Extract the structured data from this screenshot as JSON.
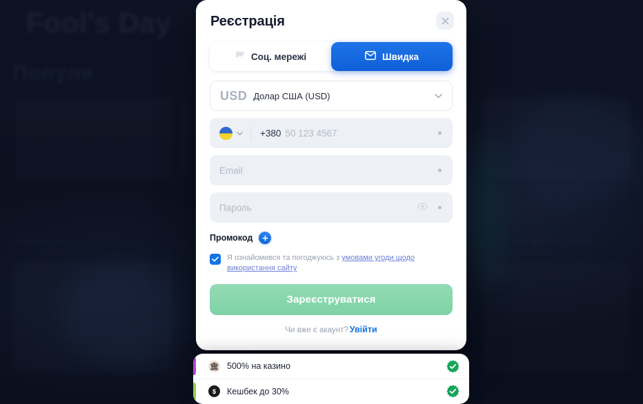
{
  "background": {
    "hero_title": "Fool's Day",
    "section_title": "Популя",
    "footer_text_1": "Популярні ігри",
    "footer_text_2": "Live Win from The Sun",
    "brand_accent": "#1273e6"
  },
  "modal": {
    "title": "Реєстрація",
    "close_label": "×",
    "tabs": [
      {
        "label": "Соц. мережі",
        "icon": "social-icon",
        "active": false
      },
      {
        "label": "Швидка",
        "icon": "envelope-icon",
        "active": true
      }
    ],
    "currency": {
      "code": "USD",
      "name": "Долар США (USD)",
      "chevron": "chevron-down-icon"
    },
    "phone": {
      "country_flag": "ukraine-flag-icon",
      "dial_code": "+380",
      "placeholder": "50 123 4567",
      "value": ""
    },
    "email": {
      "placeholder": "Email",
      "value": ""
    },
    "password": {
      "placeholder": "Пароль",
      "value": "",
      "toggle_icon": "eye-icon"
    },
    "promocode": {
      "label": "Промокод",
      "add_icon": "plus-icon"
    },
    "terms": {
      "checked": true,
      "text_before": "Я ознайомився та погоджуюсь з ",
      "link_text": "умовами угоди щодо використання сайту"
    },
    "submit_label": "Зареєструватися",
    "login_prompt": "Чи вже є акаунт?",
    "login_link": "Увійти",
    "colors": {
      "tab_active": "#0f5fd6",
      "submit": "#7fd2a6",
      "link": "#1273e6"
    }
  },
  "bonus_panel": {
    "rows": [
      {
        "label": "500% на казино",
        "icon": "casino-bank-icon",
        "accent": "#b544d8",
        "status_icon": "verified-check-icon",
        "status_color": "#1aa85a"
      },
      {
        "label": "Кешбек до 30%",
        "icon": "cashback-coin-icon",
        "accent": "#8fd14f",
        "status_icon": "verified-check-icon",
        "status_color": "#1aa85a"
      }
    ]
  }
}
